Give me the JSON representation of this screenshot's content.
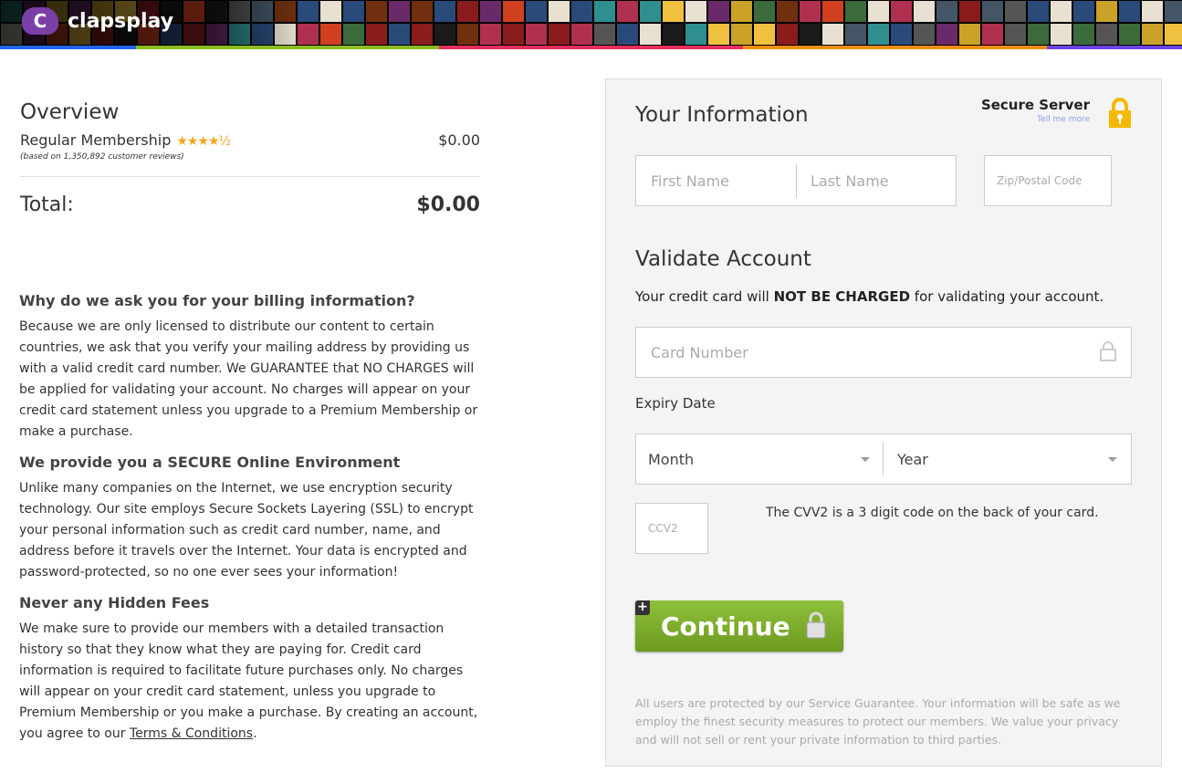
{
  "header": {
    "brand": "clapsplay",
    "logo_letter": "C",
    "stripe_colors": [
      "#2266ee",
      "#8cbc22",
      "#e8305e",
      "#f28c0f",
      "#6e44e6"
    ]
  },
  "overview": {
    "title": "Overview",
    "item": "Regular Membership",
    "rating": 4.5,
    "stars": "★★★★½",
    "price": "$0.00",
    "reviews": "(based on 1,350,892 customer reviews)",
    "total_label": "Total:",
    "total": "$0.00"
  },
  "info": [
    {
      "heading": "Why do we ask you for your billing information?",
      "body": "Because we are only licensed to distribute our content to certain countries, we ask that you verify your mailing address by providing us with a valid credit card number. We GUARANTEE that NO CHARGES will be applied for validating your account. No charges will appear on your credit card statement unless you upgrade to a Premium Membership or make a purchase."
    },
    {
      "heading": "We provide you a SECURE Online Environment",
      "body": "Unlike many companies on the Internet, we use encryption security technology. Our site employs Secure Sockets Layering (SSL) to encrypt your personal information such as credit card number, name, and address before it travels over the Internet. Your data is encrypted and password-protected, so no one ever sees your information!"
    },
    {
      "heading": "Never any Hidden Fees",
      "body": "We make sure to provide our members with a detailed transaction history so that they know what they are paying for. Credit card information is required to facilitate future purchases only. No charges will appear on your credit card statement, unless you upgrade to Premium Membership or you make a purchase. By creating an account, you agree to our ",
      "link": "Terms & Conditions",
      "end": "."
    }
  ],
  "form": {
    "your_info": "Your Information",
    "secure_server": "Secure Server",
    "tell_me_more": "Tell me more",
    "first_name": "First Name",
    "last_name": "Last Name",
    "zip": "Zip/Postal Code",
    "validate": "Validate Account",
    "note_pre": "Your credit card will ",
    "note_bold": "NOT BE CHARGED",
    "note_post": " for validating your account.",
    "card": "Card Number",
    "expiry": "Expiry Date",
    "month": "Month",
    "year": "Year",
    "ccv": "CCV2",
    "ccv_note": "The CVV2 is a 3 digit code on the back of your card.",
    "continue": "Continue",
    "footer": "All users are protected by our Service Guarantee. Your information will be safe as we employ the finest security measures to protect our members. We value your privacy and will not sell or rent your private information to third parties."
  }
}
